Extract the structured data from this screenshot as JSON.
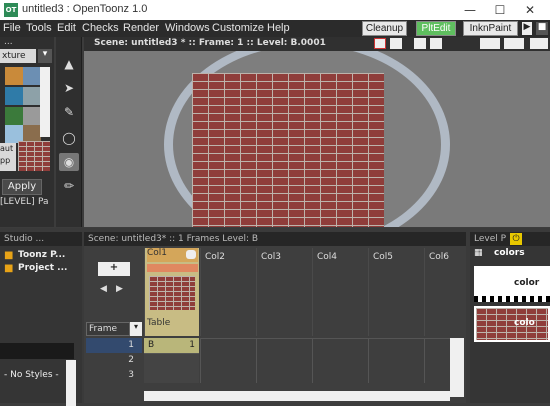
{
  "window": {
    "title": "untitled3 : OpenToonz 1.0",
    "logo": "OT"
  },
  "menu": [
    "File",
    "Tools",
    "Edit",
    "Checks",
    "Render",
    "Windows",
    "Customize",
    "Help"
  ],
  "rooms": {
    "cleanup": "Cleanup",
    "pltedit": "PltEdit",
    "inknpaint": "InknPaint"
  },
  "left_panel": {
    "dots": "...",
    "tab": "xture",
    "apply": "Apply",
    "level_label": "[LEVEL]",
    "pa": "Pa",
    "aut": "aut",
    "pp": "pp"
  },
  "viewer": {
    "header": "Scene: untitled3 *  ::  Frame: 1  ::  Level: B.0001"
  },
  "bottom": {
    "studio": "Studio ...",
    "tree": [
      "Toonz P...",
      "Project ..."
    ],
    "xsheet_header": "Scene: untitled3*  ::  1 Frames  Level: B",
    "columns": [
      "Col1",
      "Col2",
      "Col3",
      "Col4",
      "Col5",
      "Col6"
    ],
    "table": "Table",
    "frame_label": "Frame",
    "rows": [
      "1",
      "2",
      "3"
    ],
    "cell_level": "B",
    "cell_frame": "1",
    "no_styles": "- No Styles -",
    "level_palette": "Level P",
    "palette_name": "colors",
    "color_label1": "color",
    "color_label2": "colo"
  }
}
